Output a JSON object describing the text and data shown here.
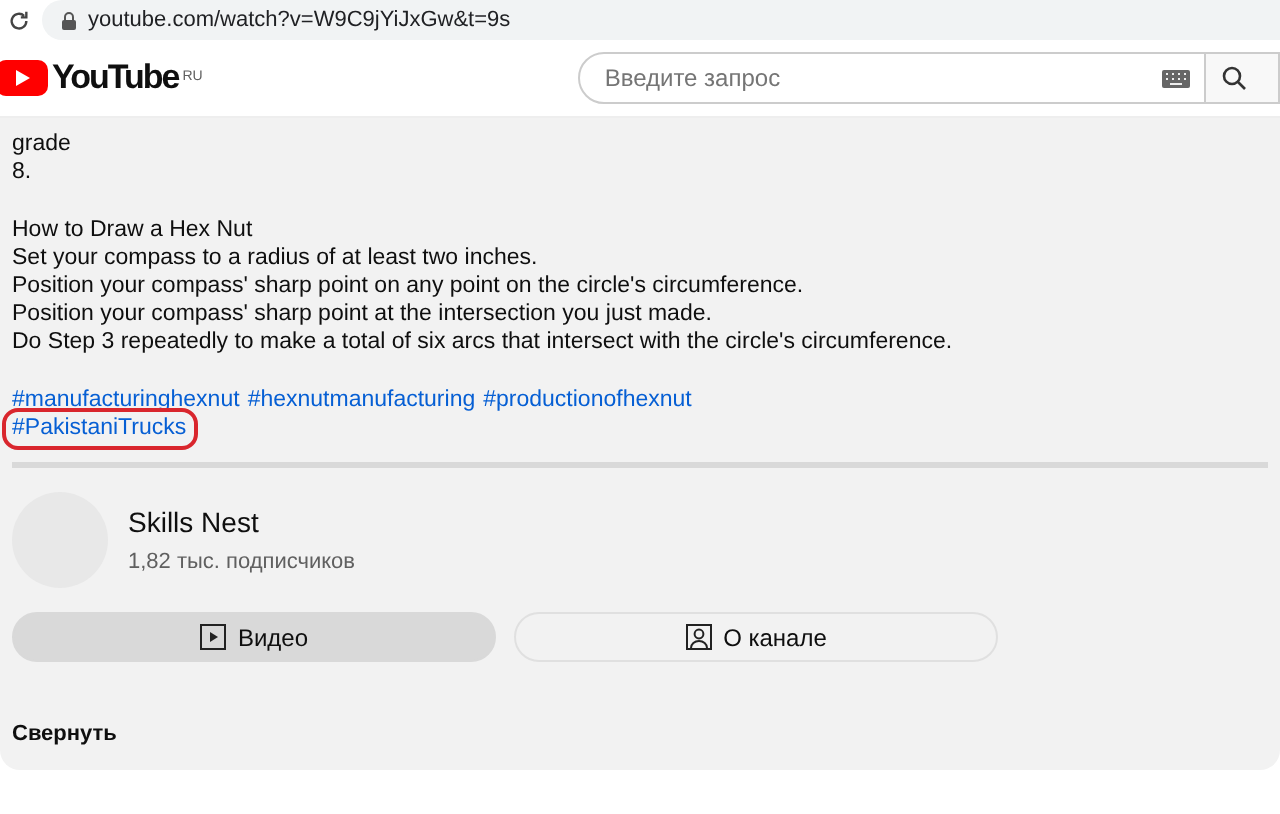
{
  "browser": {
    "url": "youtube.com/watch?v=W9C9jYiJxGw&t=9s"
  },
  "header": {
    "logo": "YouTube",
    "region": "RU",
    "search": {
      "placeholder": "Введите запрос"
    }
  },
  "description": {
    "paragraphs": [
      [
        "grade",
        "8."
      ],
      [
        "How to Draw a Hex Nut",
        "Set your compass to a radius of at least two inches.",
        "Position your compass' sharp point on any point on the circle's circumference.",
        "Position your compass' sharp point at the intersection you just made.",
        "Do Step 3 repeatedly to make a total of six arcs that intersect with the circle's circumference."
      ]
    ],
    "hashtags": [
      {
        "text": "#manufacturinghexnut",
        "highlighted": false
      },
      {
        "text": "#hexnutmanufacturing",
        "highlighted": false
      },
      {
        "text": "#productionofhexnut",
        "highlighted": false
      },
      {
        "text": "#PakistaniTrucks",
        "highlighted": true
      }
    ]
  },
  "channel": {
    "name": "Skills Nest",
    "subscribers": "1,82 тыс. подписчиков"
  },
  "buttons": [
    {
      "kind": "video",
      "label": "Видео",
      "selected": true
    },
    {
      "kind": "about",
      "label": "О канале",
      "selected": false
    }
  ],
  "collapse": "Свернуть"
}
